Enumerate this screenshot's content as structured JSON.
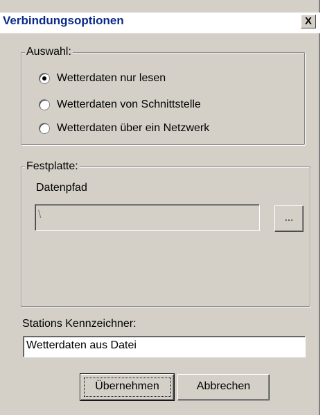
{
  "window": {
    "title": "Verbindungsoptionen",
    "close_label": "X"
  },
  "auswahl": {
    "label": "Auswahl:",
    "options": [
      {
        "label": "Wetterdaten nur lesen",
        "checked": true
      },
      {
        "label": "Wetterdaten von Schnittstelle",
        "checked": false
      },
      {
        "label": "Wetterdaten über ein Netzwerk",
        "checked": false
      }
    ]
  },
  "festplatte": {
    "label": "Festplatte:",
    "path_label": "Datenpfad",
    "path_value": "\\",
    "browse_label": "..."
  },
  "station": {
    "label": "Stations Kennzeichner:",
    "value": "Wetterdaten aus Datei"
  },
  "buttons": {
    "ok_label": "Übernehmen",
    "cancel_label": "Abbrechen"
  }
}
